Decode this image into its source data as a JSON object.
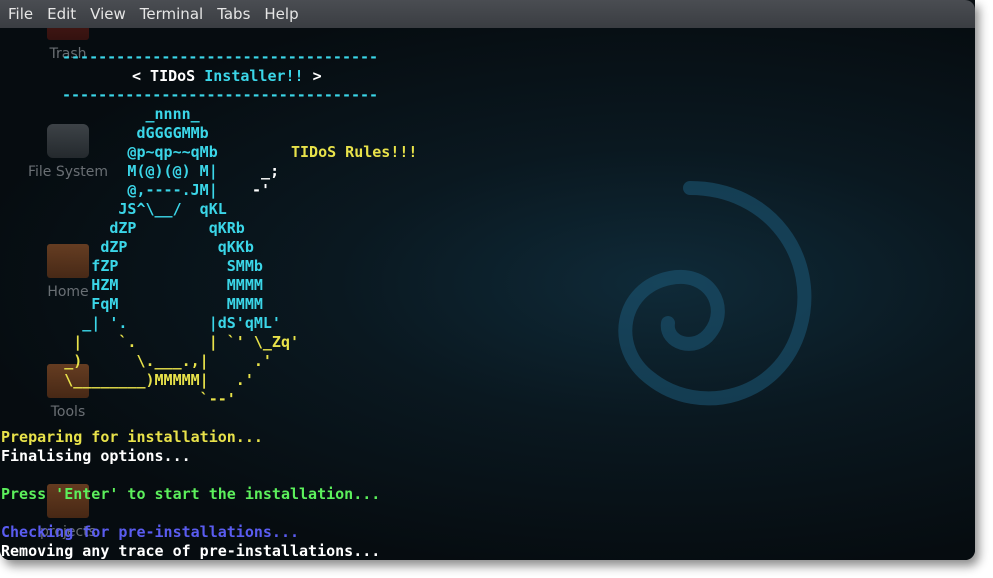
{
  "menubar": {
    "items": [
      "File",
      "Edit",
      "View",
      "Terminal",
      "Tabs",
      "Help"
    ]
  },
  "desktop_icons": [
    {
      "label": "Trash"
    },
    {
      "label": "File System"
    },
    {
      "label": "Home"
    },
    {
      "label": "Tools"
    },
    {
      "label": "projects"
    }
  ],
  "terminal": {
    "banner_rule_top": "-----------------------------------",
    "banner_prefix": "< TIDoS ",
    "banner_highlight": "Installer!!",
    "banner_suffix": " >",
    "banner_rule_bottom": "-----------------------------------",
    "art": [
      {
        "text": "                _nnnn_",
        "color": "cyan"
      },
      {
        "text": "               dGGGGMMb",
        "color": "cyan"
      },
      {
        "text": "              @p~qp~~qMb",
        "color": "cyan"
      },
      {
        "text": "              M(@)(@) M|",
        "color": "cyan"
      },
      {
        "text": "              @,----.JM|",
        "color": "cyan"
      },
      {
        "text": "             JS^\\__/  qKL",
        "color": "cyan"
      },
      {
        "text": "            dZP        qKRb",
        "color": "cyan"
      },
      {
        "text": "           dZP          qKKb",
        "color": "cyan"
      },
      {
        "text": "          fZP            SMMb",
        "color": "cyan"
      },
      {
        "text": "          HZM            MMMM",
        "color": "cyan"
      },
      {
        "text": "          FqM            MMMM",
        "color": "cyan"
      },
      {
        "text": "         _| '.         |dS'qML'",
        "color": "cyan"
      },
      {
        "text": "        |    `.        | `' \\_Zq'",
        "color": "yellow"
      },
      {
        "text": "       _)      \\.___.,|     .'",
        "color": "yellow"
      },
      {
        "text": "       \\________)MMMMM|   .'",
        "color": "yellow"
      },
      {
        "text": "                      `--'",
        "color": "yellow"
      }
    ],
    "rules_text": "TIDoS Rules!!!",
    "rules_tail_1": "  _;",
    "rules_tail_2": " -'",
    "status_lines": [
      {
        "text": "Preparing for installation...",
        "color": "yellow"
      },
      {
        "text": "Finalising options...",
        "color": "white"
      },
      {
        "text": "",
        "color": "white"
      },
      {
        "text": "Press 'Enter' to start the installation...",
        "color": "green"
      },
      {
        "text": "",
        "color": "white"
      },
      {
        "text": "Checking for pre-installations...",
        "color": "blue"
      },
      {
        "text": "Removing any trace of pre-installations...",
        "color": "white"
      }
    ]
  },
  "colors": {
    "cyan": "#3bd6e8",
    "yellow": "#e8e24a",
    "white": "#ffffff",
    "green": "#5cf05c",
    "blue": "#5a5cf0"
  }
}
